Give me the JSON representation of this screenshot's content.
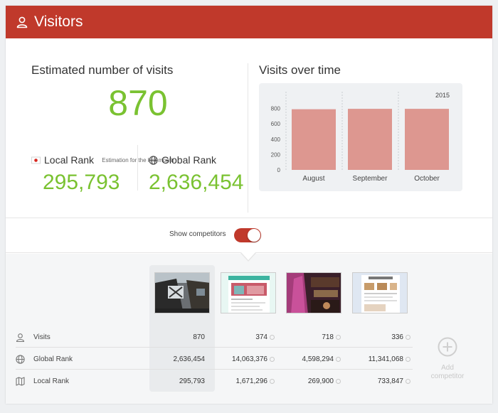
{
  "header": {
    "title": "Visitors",
    "icon": "user-icon"
  },
  "estimate": {
    "title": "Estimated number of visits",
    "value": "870",
    "subtitle": "Estimation for the last month"
  },
  "local_rank": {
    "label": "Local Rank",
    "value": "295,793",
    "icon": "japan-flag-icon"
  },
  "global_rank": {
    "label": "Global Rank",
    "value": "2,636,454",
    "icon": "globe-icon"
  },
  "chart_title": "Visits over time",
  "chart_data": {
    "type": "bar",
    "title": "Visits over time",
    "annotation": "2015",
    "categories": [
      "August",
      "September",
      "October"
    ],
    "values": [
      790,
      795,
      795
    ],
    "yticks": [
      0,
      200,
      400,
      600,
      800
    ],
    "ylim": [
      0,
      870
    ],
    "grid": false,
    "color": "#dd9790"
  },
  "competitors_toggle": {
    "label": "Show competitors",
    "on": true
  },
  "table": {
    "rows": [
      {
        "label": "Visits",
        "icon": "user-icon",
        "values": [
          "870",
          "374",
          "718",
          "336"
        ]
      },
      {
        "label": "Global Rank",
        "icon": "globe-icon",
        "values": [
          "2,636,454",
          "14,063,376",
          "4,598,294",
          "11,341,068"
        ]
      },
      {
        "label": "Local Rank",
        "icon": "map-icon",
        "values": [
          "295,793",
          "1,671,296",
          "269,900",
          "733,847"
        ]
      }
    ]
  },
  "add_competitor": {
    "line1": "Add",
    "line2": "competitor"
  },
  "colors": {
    "accent": "#c0392b",
    "positive": "#7ac231",
    "bar": "#dd9790"
  }
}
